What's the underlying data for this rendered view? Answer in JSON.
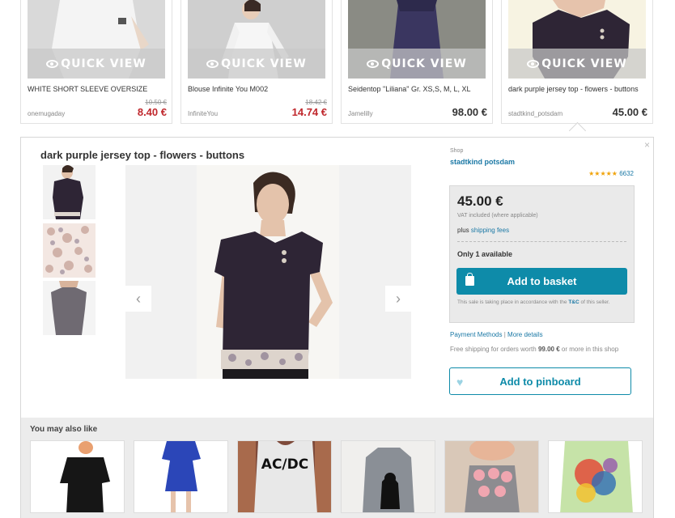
{
  "grid": {
    "quick_view_label": "QUICK VIEW",
    "cards": [
      {
        "title": "WHITE SHORT SLEEVE OVERSIZE",
        "shop": "onemugaday",
        "old_price": "10.50 €",
        "price": "8.40 €",
        "sale": true
      },
      {
        "title": "Blouse Infinite You M002",
        "shop": "InfiniteYou",
        "old_price": "18.42 €",
        "price": "14.74 €",
        "sale": true
      },
      {
        "title": "Seidentop \"Liliana\" Gr. XS,S, M, L, XL",
        "shop": "Jamelilly",
        "old_price": "",
        "price": "98.00 €",
        "sale": false
      },
      {
        "title": "dark purple jersey top - flowers - buttons",
        "shop": "stadtkind_potsdam",
        "old_price": "",
        "price": "45.00 €",
        "sale": false
      }
    ]
  },
  "detail": {
    "close": "×",
    "title": "dark purple jersey top - flowers - buttons",
    "prev_arrow": "‹",
    "next_arrow": "›",
    "shop": {
      "label": "Shop",
      "name": "stadtkind potsdam",
      "stars": "★★★★★",
      "reviews": "6632"
    },
    "buy": {
      "price": "45.00 €",
      "vat": "VAT included (where applicable)",
      "shipping_prefix": "plus",
      "shipping_link": "shipping fees",
      "availability": "Only 1 available",
      "add_to_basket": "Add to basket",
      "note_prefix": "This sale is taking place in accordance with the",
      "note_link": "T&C",
      "note_suffix": "of this seller."
    },
    "payment_methods": "Payment Methods",
    "separator": "|",
    "more_details": "More details",
    "free_shipping_prefix": "Free shipping for orders worth",
    "free_shipping_amount": "99.00 €",
    "free_shipping_suffix": "or more in this shop",
    "add_to_pinboard": "Add to pinboard"
  },
  "also_like": {
    "heading": "You may also like",
    "acdc_text": "AC/DC"
  },
  "colors": {
    "accent": "#0e8ba9",
    "sale": "#c0282d",
    "link": "#1a78a5",
    "garment": "#2e2535"
  }
}
